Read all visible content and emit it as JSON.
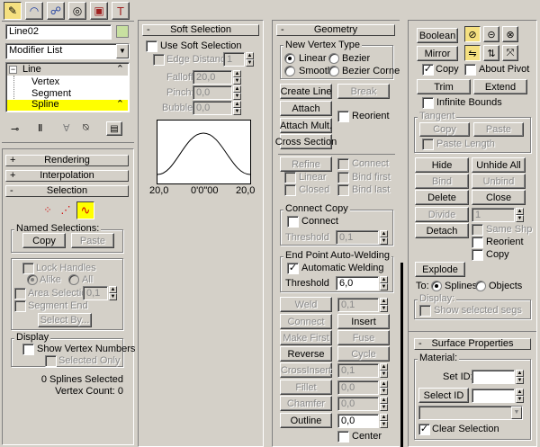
{
  "command_tabs": [
    {
      "name": "create-tab-icon"
    },
    {
      "name": "modify-tab-icon"
    },
    {
      "name": "hierarchy-tab-icon"
    },
    {
      "name": "motion-tab-icon"
    },
    {
      "name": "display-tab-icon"
    },
    {
      "name": "utilities-tab-icon"
    }
  ],
  "object": {
    "name": "Line02",
    "color": "#c8e0a0"
  },
  "modifier_list": {
    "selected": "Modifier List"
  },
  "stack": {
    "items": [
      {
        "label": "Line",
        "selected": false
      },
      {
        "label": "Vertex",
        "selected": false
      },
      {
        "label": "Segment",
        "selected": false
      },
      {
        "label": "Spline",
        "selected": true
      }
    ]
  },
  "rollouts": {
    "rendering": "Rendering",
    "interpolation": "Interpolation",
    "selection": "Selection",
    "soft_selection": "Soft Selection",
    "geometry": "Geometry",
    "surface_properties": "Surface Properties"
  },
  "selection": {
    "named_selections": "Named Selections:",
    "copy": "Copy",
    "paste": "Paste",
    "lock_handles": "Lock Handles",
    "alike": "Alike",
    "all": "All",
    "area_selection": "Area Selection:",
    "area_value": "0,1",
    "segment_end": "Segment End",
    "select_by": "Select By...",
    "display": "Display",
    "show_vertex_numbers": "Show Vertex Numbers",
    "selected_only": "Selected Only",
    "status1": "0 Splines Selected",
    "status2": "Vertex Count: 0"
  },
  "soft_selection": {
    "use": "Use Soft Selection",
    "edge_distance": "Edge Distance:",
    "edge_value": "1",
    "falloff": "Falloff:",
    "falloff_value": "20,0",
    "pinch": "Pinch:",
    "pinch_value": "0,0",
    "bubble": "Bubble:",
    "bubble_value": "0,0",
    "graph_left": "20,0",
    "graph_mid": "0'0\"00",
    "graph_right": "20,0"
  },
  "geometry": {
    "new_vertex_type": "New Vertex Type",
    "linear": "Linear",
    "bezier": "Bezier",
    "smooth": "Smooth",
    "bezier_corner": "Bezier Corner",
    "create_line": "Create Line",
    "break": "Break",
    "attach": "Attach",
    "reorient": "Reorient",
    "attach_mult": "Attach Mult.",
    "cross_section": "Cross Section",
    "refine": "Refine",
    "connect": "Connect",
    "linear2": "Linear",
    "bind_first": "Bind first",
    "closed": "Closed",
    "bind_last": "Bind last",
    "connect_copy": "Connect Copy",
    "connect2": "Connect",
    "threshold": "Threshold",
    "threshold_value1": "0,1",
    "end_point_welding": "End Point Auto-Welding",
    "automatic_welding": "Automatic Welding",
    "threshold_value2": "6,0",
    "weld": "Weld",
    "weld_value": "0,1",
    "connect_btn": "Connect",
    "insert": "Insert",
    "make_first": "Make First",
    "fuse": "Fuse",
    "reverse": "Reverse",
    "cycle": "Cycle",
    "crossinsert": "CrossInsert",
    "crossinsert_value": "0,1",
    "fillet": "Fillet",
    "fillet_value": "0,0",
    "chamfer": "Chamfer",
    "chamfer_value": "0,0",
    "outline": "Outline",
    "outline_value": "0,0",
    "center": "Center"
  },
  "right": {
    "boolean": "Boolean",
    "mirror": "Mirror",
    "copy": "Copy",
    "about_pivot": "About Pivot",
    "trim": "Trim",
    "extend": "Extend",
    "infinite_bounds": "Infinite Bounds",
    "tangent": "Tangent",
    "tangent_copy": "Copy",
    "tangent_paste": "Paste",
    "paste_length": "Paste Length",
    "hide": "Hide",
    "unhide_all": "Unhide All",
    "bind": "Bind",
    "unbind": "Unbind",
    "delete": "Delete",
    "close": "Close",
    "divide": "Divide",
    "divide_value": "1",
    "detach": "Detach",
    "same_shp": "Same Shp",
    "reorient": "Reorient",
    "copy2": "Copy",
    "explode": "Explode",
    "to": "To:",
    "splines": "Splines",
    "objects": "Objects",
    "display": "Display:",
    "show_selected_segs": "Show selected segs",
    "material": "Material:",
    "set_id": "Set ID:",
    "select_id": "Select ID",
    "clear_selection": "Clear Selection"
  }
}
